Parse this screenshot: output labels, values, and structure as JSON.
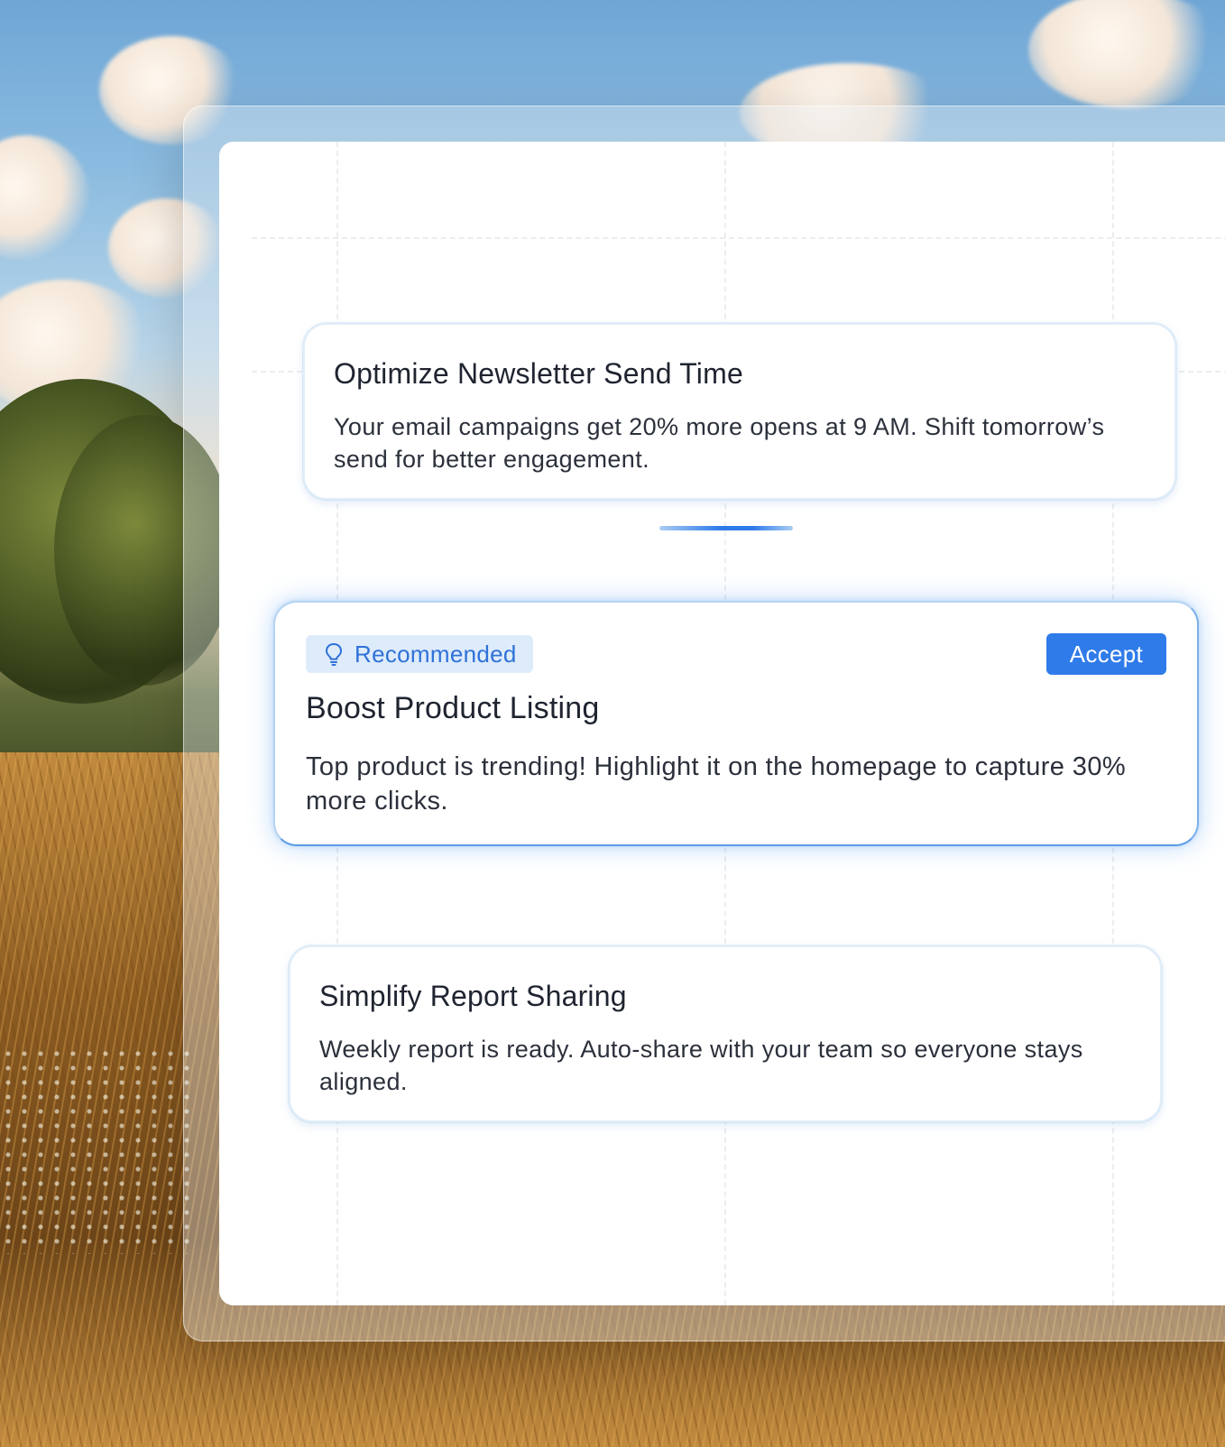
{
  "colors": {
    "accent": "#2f7bea",
    "badge_bg": "#deebfb",
    "badge_text": "#2f72d8",
    "text": "#1f2430"
  },
  "suggestions": [
    {
      "title": "Optimize Newsletter Send Time",
      "description": "Your email campaigns get 20% more opens at 9 AM. Shift tomorrow’s send for better engagement."
    },
    {
      "badge": {
        "icon": "lightbulb-icon",
        "label": "Recommended"
      },
      "action_label": "Accept",
      "title": "Boost Product Listing",
      "description": "Top product is trending! Highlight it on the homepage to capture 30% more clicks."
    },
    {
      "title": "Simplify Report Sharing",
      "description": "Weekly report is ready. Auto-share with your team so everyone stays aligned."
    }
  ],
  "progress": {
    "value": 1.0
  }
}
